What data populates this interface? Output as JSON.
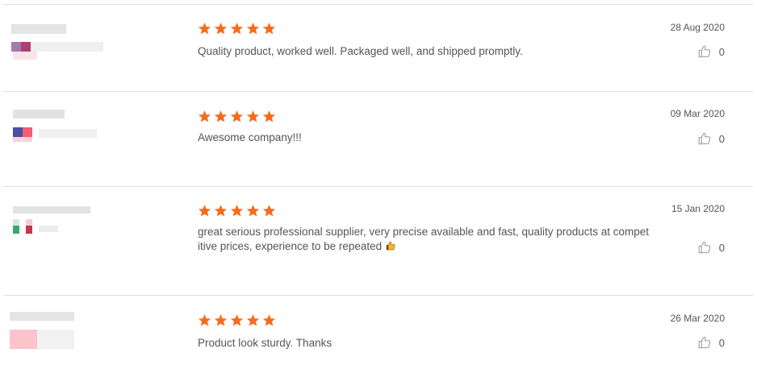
{
  "reviews": [
    {
      "rating": 5,
      "text": "Quality product, worked well. Packaged well, and shipped promptly.",
      "date": "28 Aug 2020",
      "likes": "0",
      "avatar_colors": [
        "#a57aa6",
        "#b13f6e",
        "#f3c2cb"
      ]
    },
    {
      "rating": 5,
      "text": "Awesome company!!!",
      "date": "09 Mar 2020",
      "likes": "0",
      "avatar_colors": [
        "#4a4fa3",
        "#f35f6e",
        "#c9c9dc"
      ]
    },
    {
      "rating": 5,
      "text": "great serious professional supplier, very precise available and fast, quality products at competitive prices, experience to be repeated",
      "date": "15 Jan 2020",
      "likes": "0",
      "avatar_colors": [
        "#3aa86b",
        "#c2374a",
        "#e6e6e6"
      ]
    },
    {
      "rating": 5,
      "text": "Product look sturdy. Thanks",
      "date": "26 Mar 2020",
      "likes": "0",
      "avatar_colors": [
        "#f9a9b1",
        "#fcd0d4",
        "#eeeeee"
      ]
    }
  ],
  "colors": {
    "star": "#f76b1c",
    "divider": "#dedede",
    "text": "#555555"
  },
  "icons": {
    "star": "star-icon",
    "like": "thumbs-up-icon",
    "emoji": "thumbs-up-emoji"
  }
}
